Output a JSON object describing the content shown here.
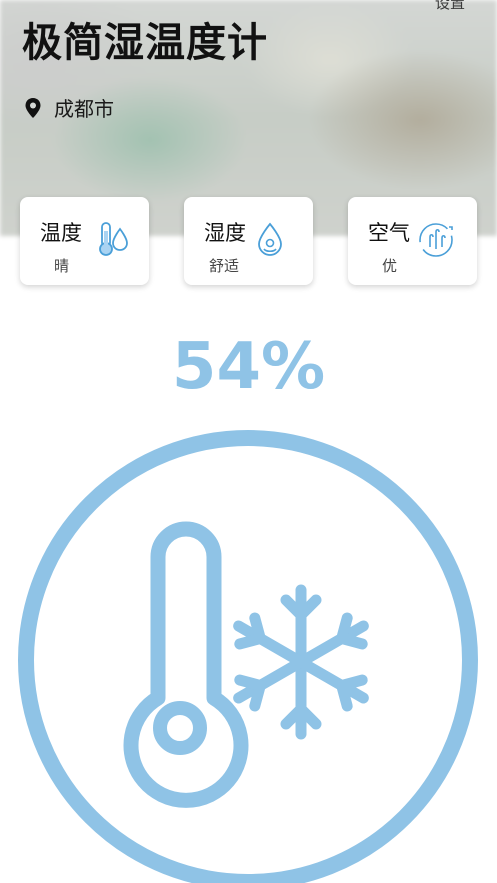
{
  "header": {
    "title": "极简湿温度计",
    "settings_label": "设置",
    "location": "成都市"
  },
  "cards": [
    {
      "title": "温度",
      "subtitle": "晴",
      "icon": "thermometer-drop-icon"
    },
    {
      "title": "湿度",
      "subtitle": "舒适",
      "icon": "water-drop-icon"
    },
    {
      "title": "空气",
      "subtitle": "优",
      "icon": "air-flow-icon"
    }
  ],
  "main": {
    "humidity_value": "54%",
    "icon": "thermometer-snowflake-icon"
  },
  "colors": {
    "accent": "#8fc3e6",
    "icon_blue": "#4a9fd8"
  }
}
